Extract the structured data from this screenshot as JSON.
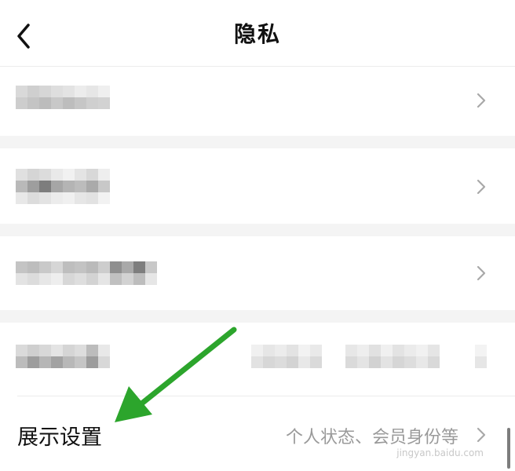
{
  "nav": {
    "title": "隐私",
    "back_icon": "chevron-left-icon"
  },
  "rows": [
    {
      "label": "",
      "value": "",
      "icon": "chevron-right-icon",
      "blurred": true
    },
    {
      "label": "",
      "value": "",
      "icon": "chevron-right-icon",
      "blurred": true
    },
    {
      "label": "",
      "value": "",
      "icon": "chevron-right-icon",
      "blurred": true
    },
    {
      "label": "",
      "value": "",
      "icon": "",
      "blurred": true
    },
    {
      "label": "展示设置",
      "value": "个人状态、会员身份等",
      "icon": "chevron-right-icon",
      "blurred": false
    }
  ],
  "annotation": {
    "icon": "green-arrow-icon",
    "color": "#2ca52c"
  },
  "watermark": "jingyan.baidu.com",
  "colors": {
    "background": "#ffffff",
    "section_gap": "#f4f4f4",
    "secondary_text": "#9a9a9a"
  }
}
